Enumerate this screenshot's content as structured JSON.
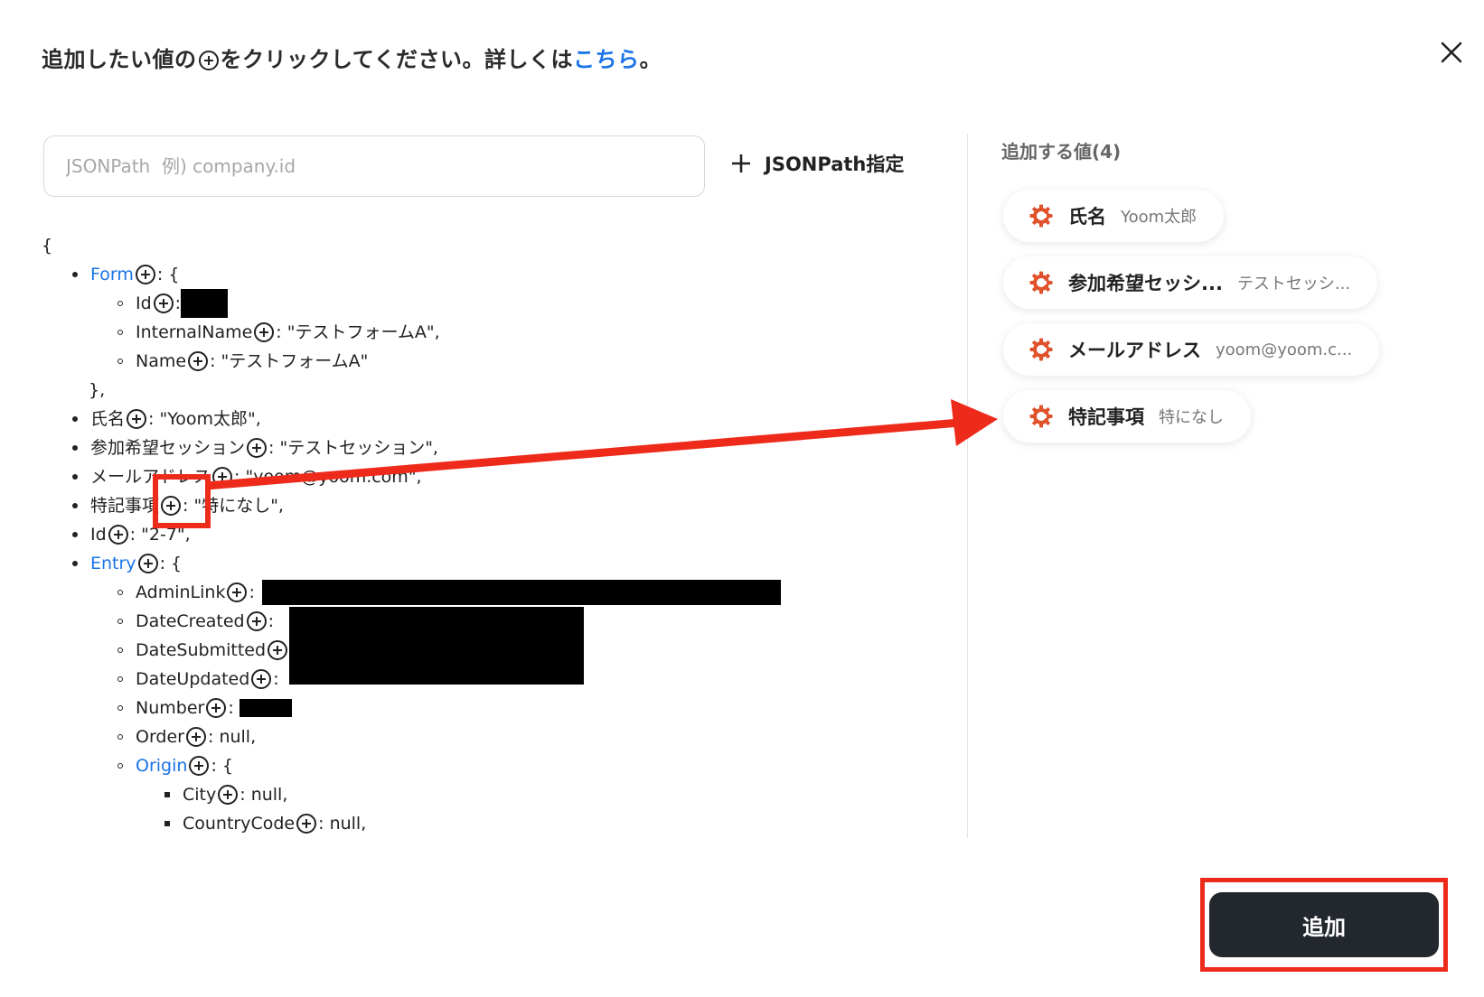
{
  "header": {
    "text_before": "追加したい値の",
    "text_middle": "をクリックしてください。詳しくは",
    "link": "こちら",
    "text_after": "。",
    "plus_icon": "plus-circle-icon",
    "close_icon": "close-icon"
  },
  "search": {
    "placeholder": "JSONPath  例) company.id",
    "value": ""
  },
  "jsonpath_button": {
    "label": "JSONPath指定",
    "icon": "plus-icon"
  },
  "tree": {
    "open_brace": "{",
    "form_key": "Form",
    "form_open": ": {",
    "form_id_key": "Id",
    "form_id_sep": ": ",
    "form_internal_key": "InternalName",
    "form_internal_value": ": \"テストフォームA\",",
    "form_name_key": "Name",
    "form_name_value": ": \"テストフォームA\"",
    "form_close": "},",
    "name_key": "氏名",
    "name_value": ": \"Yoom太郎\",",
    "session_key": "参加希望セッション",
    "session_value": ": \"テストセッション\",",
    "mail_key": "メールアドレス",
    "mail_value": ": \"yoom@yoom.com\",",
    "note_key": "特記事項",
    "note_value": ": \"特になし\",",
    "id_key": "Id",
    "id_value": ": \"2-7\",",
    "entry_key": "Entry",
    "entry_open": ": {",
    "admin_key": "AdminLink",
    "created_key": "DateCreated",
    "submitted_key": "DateSubmitted",
    "updated_key": "DateUpdated",
    "number_key": "Number",
    "order_key": "Order",
    "order_value": ": null,",
    "origin_key": "Origin",
    "origin_open": ": {",
    "city_key": "City",
    "city_value": ": null,",
    "country_key": "CountryCode",
    "country_value": ": null,",
    "colon": ":"
  },
  "right_panel": {
    "title": "追加する値(4)",
    "chips": [
      {
        "label": "氏名",
        "value": "Yoom太郎"
      },
      {
        "label": "参加希望セッシ...",
        "value": "テストセッシ..."
      },
      {
        "label": "メールアドレス",
        "value": "yoom@yoom.c..."
      },
      {
        "label": "特記事項",
        "value": "特になし"
      }
    ],
    "chip_icon": "gear-icon"
  },
  "add_button": {
    "label": "追加"
  },
  "colors": {
    "link": "#1a73e8",
    "gear": "#e0522b",
    "annotation": "#ee2a1b",
    "button_bg": "#23272e"
  }
}
